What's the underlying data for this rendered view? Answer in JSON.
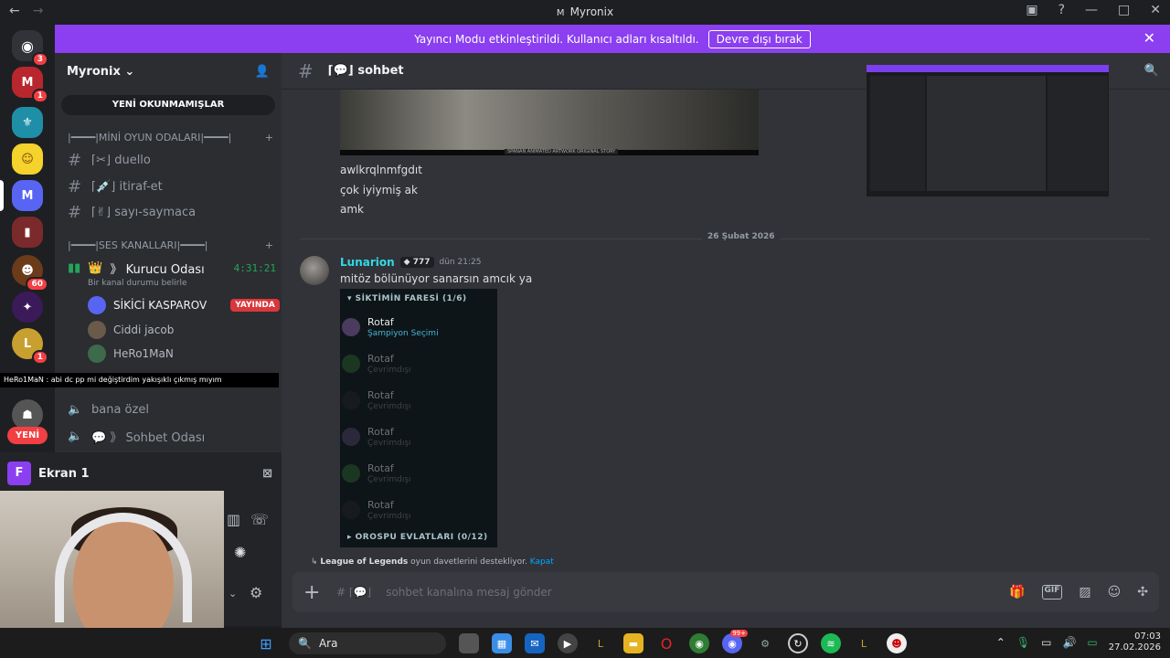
{
  "window": {
    "title": "Myronix",
    "icon": "M"
  },
  "banner": {
    "text": "Yayıncı Modu etkinleştirildi. Kullanıcı adları kısaltıldı.",
    "button": "Devre dışı bırak"
  },
  "servers": {
    "badges": [
      "3",
      "1",
      "60",
      "1"
    ],
    "current_letter": "M",
    "new_label": "YENİ"
  },
  "sidebar": {
    "guild_name": "Myronix",
    "unread_button": "YENİ OKUNMAMIŞLAR",
    "category1": "|━━━━|MİNİ OYUN ODALARI|━━━━|",
    "channels": [
      {
        "icon": "✂",
        "name": "duello"
      },
      {
        "icon": "💉",
        "name": "itiraf-et"
      },
      {
        "icon": "✌",
        "name": "sayı-saymaca"
      }
    ],
    "category2": "|━━━━|SES KANALLARI|━━━━|",
    "voice_channel": {
      "icon": "👑",
      "name": "Kurucu Odası",
      "timer": "4:31:21",
      "status": "Bir kanal durumu belirle"
    },
    "voice_users": [
      {
        "name": "SİKİCİ KASPAROV",
        "badge": "YAYINDA"
      },
      {
        "name": "Ciddi jacob"
      },
      {
        "name": "HeRo1MaN"
      }
    ],
    "overlay_message": "HeRo1MaN : abi dc pp mi değiştirdim yakışıklı çıkmış mıyım",
    "voice_channels_extra": [
      {
        "name": "bana özel"
      },
      {
        "icon": "💬",
        "name": "Sohbet Odası"
      }
    ]
  },
  "panel": {
    "letter": "F",
    "title": "Ekran 1"
  },
  "channel": {
    "icon": "💬",
    "name": "sohbet"
  },
  "messages": {
    "lines": [
      "awlkrqlnmfgdıt",
      "çok iyiymiş ak",
      "amk"
    ],
    "video_caption": "SPANAN ANIMATED ARTWORK ORIGINAL STORY",
    "date_divider": "26 Şubat 2026",
    "author": "Lunarion",
    "author_tag": "777",
    "time": "dün 21:25",
    "text": "mitöz bölünüyor sanarsın amcık ya",
    "embed": {
      "header": "▾ SİKTİMİN FARESİ (1/6)",
      "players": [
        {
          "name": "Rotaf",
          "status": "Şampiyon Seçimi",
          "active": true
        },
        {
          "name": "Rotaf",
          "status": "Çevrimdışı"
        },
        {
          "name": "Rotaf",
          "status": "Çevrimdışı"
        },
        {
          "name": "Rotaf",
          "status": "Çevrimdışı"
        },
        {
          "name": "Rotaf",
          "status": "Çevrimdışı"
        },
        {
          "name": "Rotaf",
          "status": "Çevrimdışı"
        }
      ],
      "footer": "▸ OROSPU EVLATLARI (0/12)"
    },
    "lol_note": {
      "game": "League of Legends",
      "text": " oyun davetlerini destekliyor.",
      "link": "Kapat"
    }
  },
  "composer": {
    "placeholder": "sohbet kanalına mesaj gönder",
    "prefix": "# ⌈💬⌋"
  },
  "taskbar": {
    "search": "Ara",
    "time": "07:03",
    "date": "27.02.2026",
    "discord_badge": "99+"
  },
  "colors": {
    "accent": "#8b3ff0",
    "live": "#da373c",
    "username": "#33d9e6"
  }
}
